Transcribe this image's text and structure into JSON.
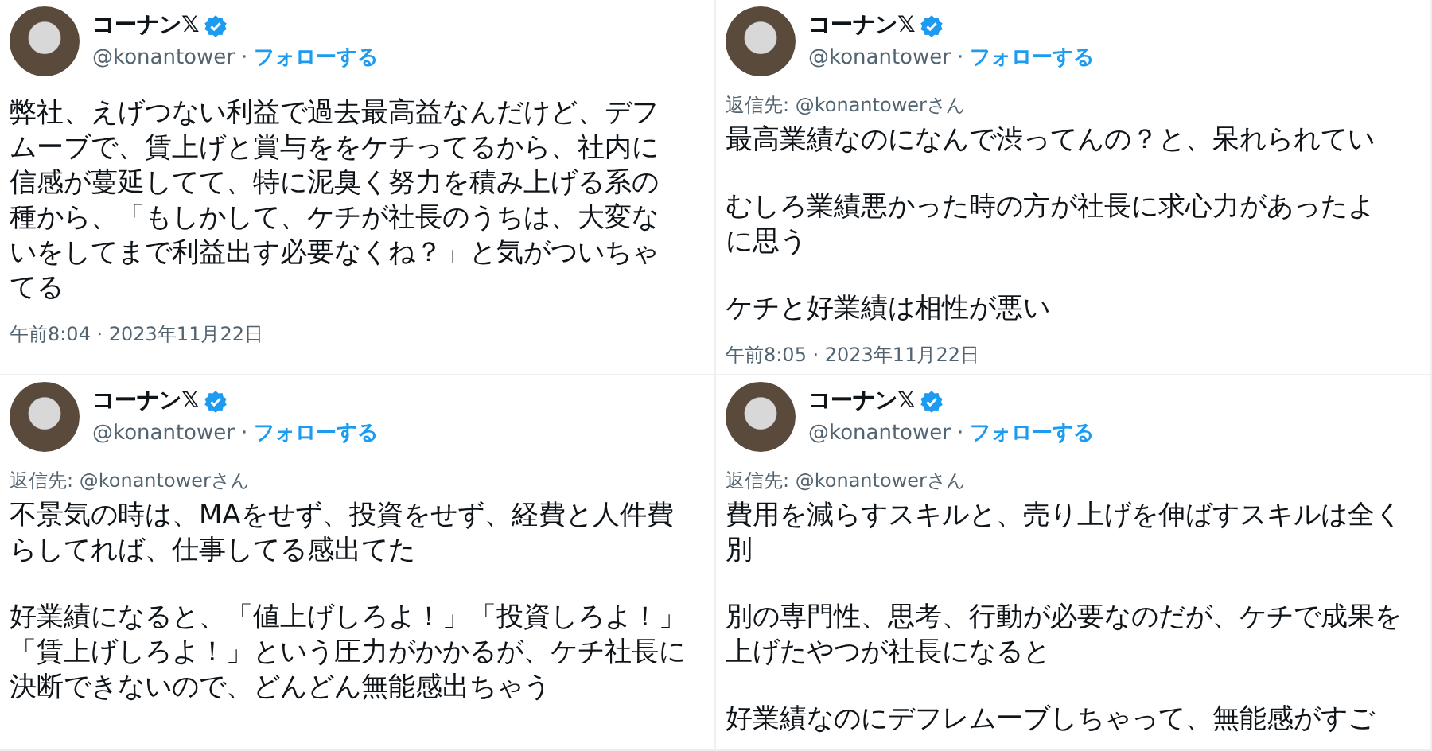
{
  "tweets": [
    {
      "name": "コーナン𝕏",
      "verified": true,
      "handle": "@konantower",
      "separator": "·",
      "follow": "フォローする",
      "paragraphs": [
        [
          "弊社、えげつない利益で過去最高益なんだけど、デフ",
          "ムーブで、賃上げと賞与ををケチってるから、社内に",
          "信感が蔓延してて、特に泥臭く努力を積み上げる系の",
          "種から、「もしかして、ケチが社長のうちは、大変な",
          "いをしてまで利益出す必要なくね？」と気がついちゃ",
          "てる"
        ]
      ],
      "timestamp": "午前8:04 · 2023年11月22日"
    },
    {
      "name": "コーナン𝕏",
      "verified": true,
      "handle": "@konantower",
      "separator": "·",
      "follow": "フォローする",
      "reply_to": "返信先: @konantowerさん",
      "paragraphs": [
        [
          "最高業績なのになんで渋ってんの？と、呆れられてい"
        ],
        [
          "むしろ業績悪かった時の方が社長に求心力があったよ",
          "に思う"
        ],
        [
          "ケチと好業績は相性が悪い"
        ]
      ],
      "timestamp": "午前8:05 · 2023年11月22日"
    },
    {
      "name": "コーナン𝕏",
      "verified": true,
      "handle": "@konantower",
      "separator": "·",
      "follow": "フォローする",
      "reply_to": "返信先: @konantowerさん",
      "paragraphs": [
        [
          "不景気の時は、MAをせず、投資をせず、経費と人件費",
          "らしてれば、仕事してる感出てた"
        ],
        [
          "好業績になると、「値上げしろよ！」「投資しろよ！」",
          "「賃上げしろよ！」という圧力がかかるが、ケチ社長に",
          "決断できないので、どんどん無能感出ちゃう"
        ]
      ]
    },
    {
      "name": "コーナン𝕏",
      "verified": true,
      "handle": "@konantower",
      "separator": "·",
      "follow": "フォローする",
      "reply_to": "返信先: @konantowerさん",
      "paragraphs": [
        [
          "費用を減らすスキルと、売り上げを伸ばすスキルは全く",
          "別"
        ],
        [
          "別の専門性、思考、行動が必要なのだが、ケチで成果を",
          "上げたやつが社長になると"
        ],
        [
          "好業績なのにデフレムーブしちゃって、無能感がすご"
        ]
      ]
    }
  ]
}
